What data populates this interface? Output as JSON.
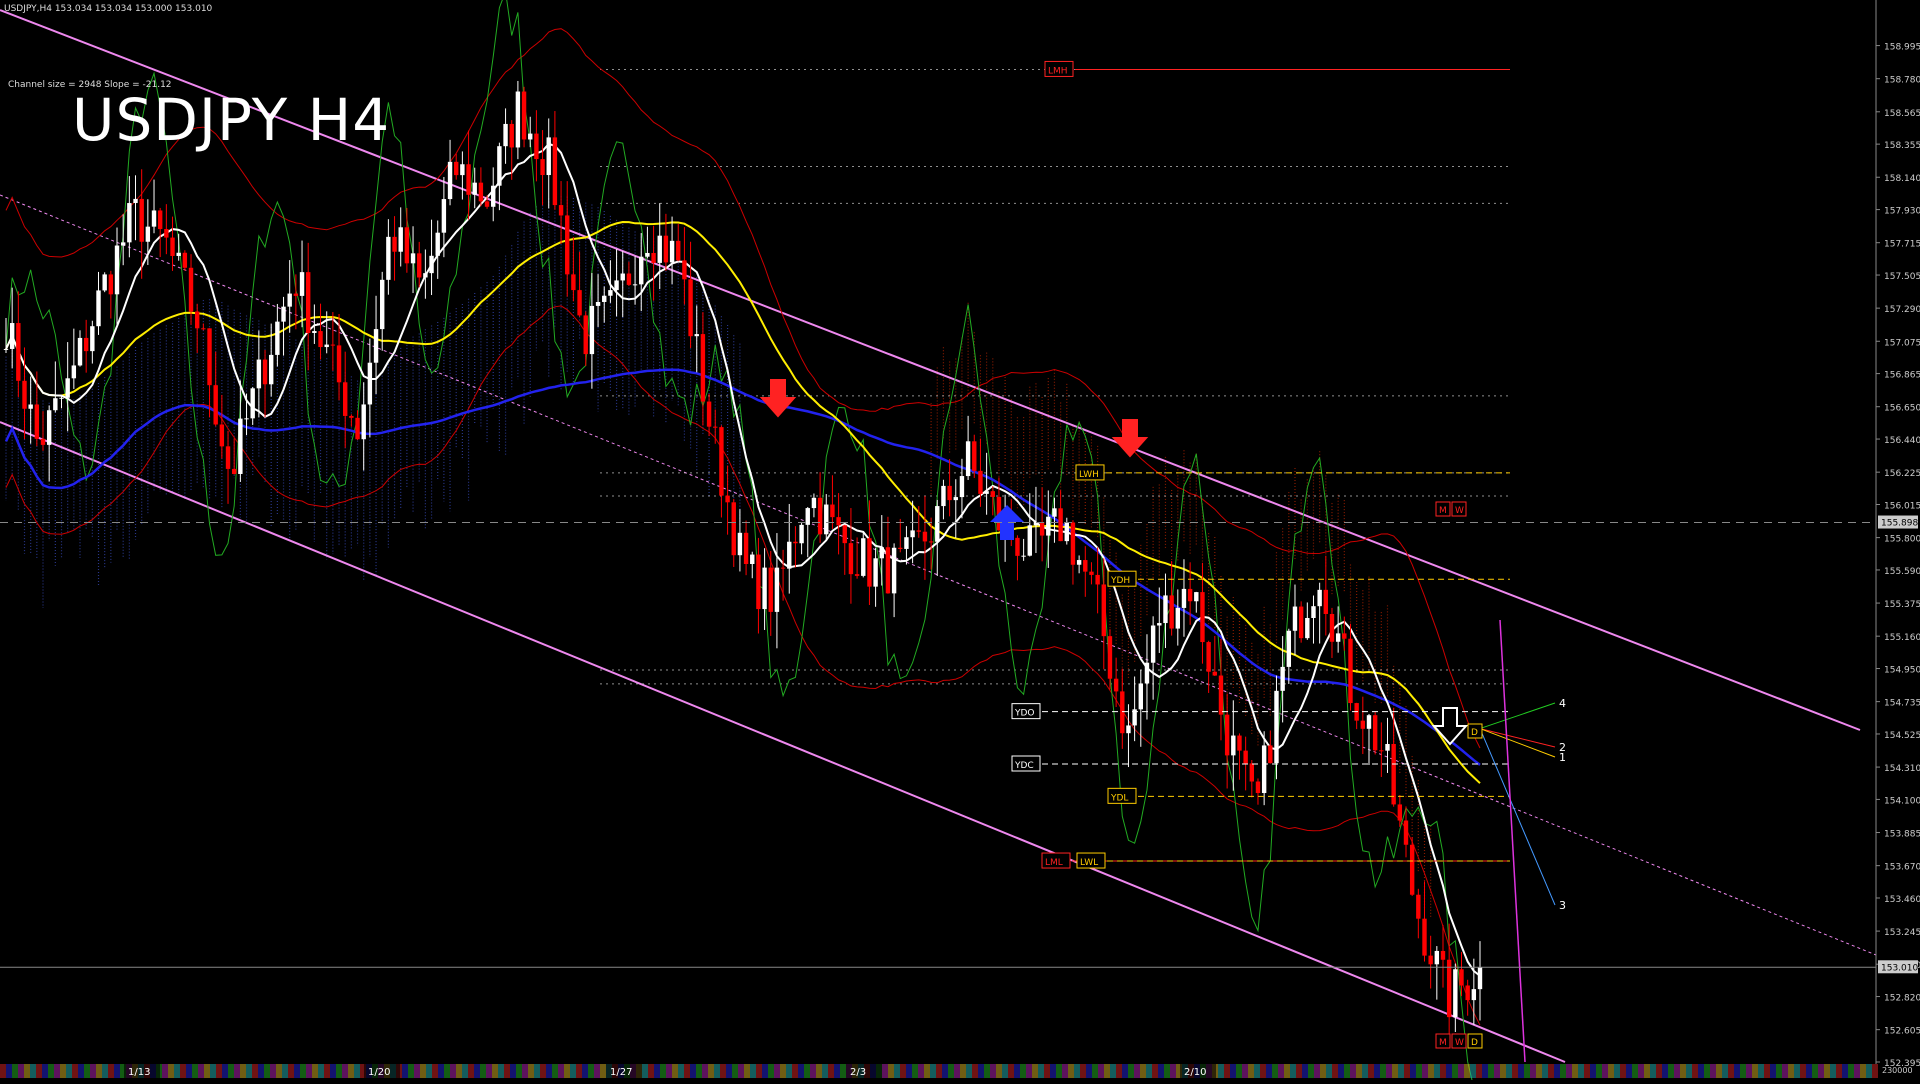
{
  "header": {
    "symbol_line": "USDJPY,H4  153.034 153.034 153.000 153.010",
    "channel_info": "Channel size = 2948 Slope = -21.12",
    "title": "USDJPY H4"
  },
  "colors": {
    "background": "#000000",
    "bull_candle": "#ffffff",
    "bear_candle": "#ff0000",
    "channel": "#ee88ee",
    "ma_white": "#ffffff",
    "ma_yellow": "#ffee00",
    "ma_blue": "#2222ee",
    "bollinger": "#cc0000",
    "green_line": "#22aa22",
    "ichimoku_cloud": "#3344aa"
  },
  "chart_data": {
    "type": "candlestick",
    "timeframe": "H4",
    "ylim": [
      152.395,
      159.2
    ],
    "y_ticks": [
      "158.995",
      "158.780",
      "158.565",
      "158.355",
      "158.140",
      "157.930",
      "157.715",
      "157.505",
      "157.290",
      "157.075",
      "156.865",
      "156.650",
      "156.440",
      "156.225",
      "156.015",
      "155.800",
      "155.590",
      "155.375",
      "155.160",
      "154.950",
      "154.735",
      "154.525",
      "154.310",
      "154.100",
      "153.885",
      "153.670",
      "153.460",
      "153.245",
      "153.030",
      "152.820",
      "152.605",
      "152.395"
    ],
    "x_date_labels": [
      "1/13",
      "1/20",
      "1/27",
      "2/3",
      "2/10"
    ],
    "current_price": "153.010",
    "marked_price": "155.898",
    "volume_label": "230000",
    "close_path": [
      157.2,
      156.4,
      156.8,
      157.4,
      157.9,
      157.7,
      157.2,
      156.2,
      156.9,
      157.5,
      157.0,
      156.5,
      157.8,
      157.4,
      158.2,
      158.0,
      158.6,
      158.2,
      157.1,
      157.3,
      157.8,
      157.6,
      156.5,
      155.6,
      155.4,
      156.1,
      155.8,
      155.6,
      155.6,
      155.9,
      156.3,
      155.9,
      155.7,
      155.9,
      155.4,
      154.5,
      155.3,
      155.5,
      154.6,
      154.0,
      155.1,
      155.6,
      154.8,
      154.4,
      153.4,
      152.8,
      153.01
    ],
    "levels": [
      {
        "label": "LMH",
        "value": 158.84
      },
      {
        "label": "LWH",
        "value": 156.22
      },
      {
        "label": "YDH",
        "value": 155.53
      },
      {
        "label": "YDO",
        "value": 154.67
      },
      {
        "label": "YDC",
        "value": 154.33
      },
      {
        "label": "YDL",
        "value": 154.12
      },
      {
        "label": "LML",
        "value": 153.7
      },
      {
        "label": "LWL",
        "value": 153.7
      }
    ],
    "dotted_levels": [
      158.84,
      158.21,
      157.97,
      156.72,
      156.22,
      156.07,
      154.94,
      154.85
    ],
    "projection_labels": [
      "4",
      "2",
      "1",
      "3"
    ],
    "mwd_boxes_top": [
      "M",
      "W"
    ],
    "mwd_boxes_mid": [
      "D"
    ],
    "mwd_boxes_bottom": [
      "M",
      "W",
      "D"
    ]
  }
}
